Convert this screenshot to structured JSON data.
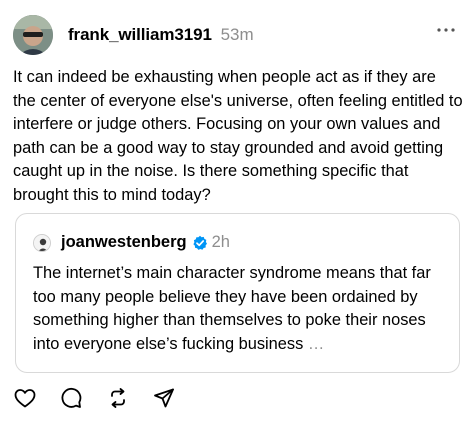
{
  "post": {
    "author": "frank_william3191",
    "time": "53m",
    "text": "It can indeed be exhausting when people act as if they are the center of everyone else's universe, often feeling entitled to interfere or judge others. Focusing on your own values and path can be a good way to stay grounded and avoid getting caught up in the noise. Is there something specific that brought this to mind today?",
    "more_icon": "ellipsis-horizontal-icon"
  },
  "quote": {
    "author": "joanwestenberg",
    "verified": true,
    "time": "2h",
    "text": "The internet’s main character syndrome means that far too many people believe they have been ordained by something higher than themselves to poke their noses into everyone else’s fucking business",
    "ellipsis": "…"
  },
  "actions": [
    {
      "icon": "heart-icon"
    },
    {
      "icon": "comment-icon"
    },
    {
      "icon": "repost-icon"
    },
    {
      "icon": "share-icon"
    }
  ],
  "colors": {
    "text": "#000000",
    "muted": "#8e8e8e",
    "border": "#d9d9d9",
    "verified": "#0095f6"
  }
}
